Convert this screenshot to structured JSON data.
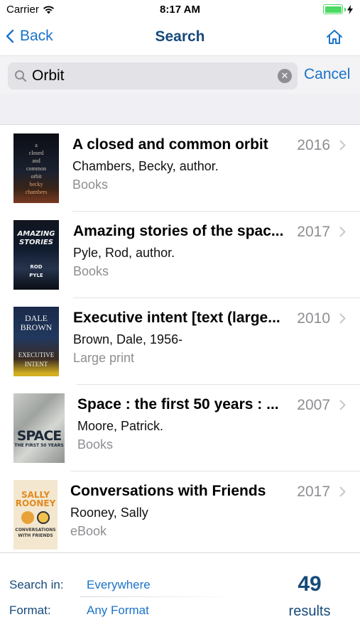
{
  "status_bar": {
    "carrier": "Carrier",
    "time": "8:17 AM"
  },
  "nav": {
    "back_label": "Back",
    "title": "Search"
  },
  "search": {
    "value": "Orbit",
    "cancel_label": "Cancel"
  },
  "results": [
    {
      "title": "A closed and common orbit",
      "year": "2016",
      "author": "Chambers, Becky, author.",
      "format": "Books",
      "cover_text": [
        "a",
        "closed",
        "and",
        "common",
        "orbit",
        "becky",
        "chambers"
      ]
    },
    {
      "title": "Amazing stories of the spac...",
      "year": "2017",
      "author": "Pyle, Rod, author.",
      "format": "Books",
      "cover_text": [
        "AMAZING",
        "STORIES",
        "ROD",
        "PYLE"
      ]
    },
    {
      "title": "Executive intent [text (large...",
      "year": "2010",
      "author": "Brown, Dale, 1956-",
      "format": "Large print",
      "cover_text": [
        "DALE",
        "BROWN",
        "EXECUTIVE",
        "INTENT"
      ]
    },
    {
      "title": "Space : the first 50 years : ...",
      "year": "2007",
      "author": "Moore, Patrick.",
      "format": "Books",
      "cover_text": [
        "SPACE",
        "THE FIRST 50 YEARS"
      ]
    },
    {
      "title": "Conversations with Friends",
      "year": "2017",
      "author": "Rooney, Sally",
      "format": "eBook",
      "cover_text": [
        "SALLY",
        "ROONEY",
        "CONVERSATIONS",
        "WITH FRIENDS"
      ]
    }
  ],
  "footer": {
    "search_in_label": "Search in:",
    "search_in_value": "Everywhere",
    "format_label": "Format:",
    "format_value": "Any Format",
    "count": "49",
    "results_label": "results"
  },
  "colors": {
    "accent": "#1a73c8",
    "title_navy": "#164a7a",
    "battery_green": "#4cd964",
    "secondary_gray": "#8e8e93"
  }
}
